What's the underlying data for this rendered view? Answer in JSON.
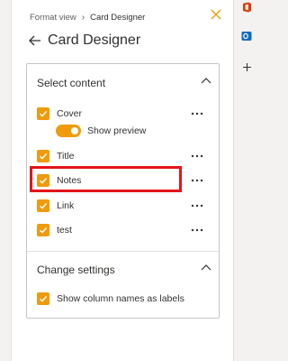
{
  "breadcrumb": {
    "parent": "Format view",
    "current": "Card Designer"
  },
  "header": {
    "title": "Card Designer"
  },
  "select_content": {
    "heading": "Select content",
    "items": [
      {
        "label": "Cover",
        "checked": true
      },
      {
        "label": "Title",
        "checked": true
      },
      {
        "label": "Notes",
        "checked": true
      },
      {
        "label": "Link",
        "checked": true
      },
      {
        "label": "test",
        "checked": true
      }
    ],
    "show_preview": {
      "label": "Show preview",
      "on": true
    }
  },
  "change_settings": {
    "heading": "Change settings",
    "show_column_names": {
      "label": "Show column names as labels",
      "checked": true
    }
  },
  "rail": {
    "icons": [
      "office-icon",
      "outlook-icon",
      "add-icon"
    ]
  },
  "colors": {
    "accent": "#ef9b0c",
    "highlight": "#e3141c",
    "office": "#d83b01",
    "outlook": "#0f6cbd"
  }
}
